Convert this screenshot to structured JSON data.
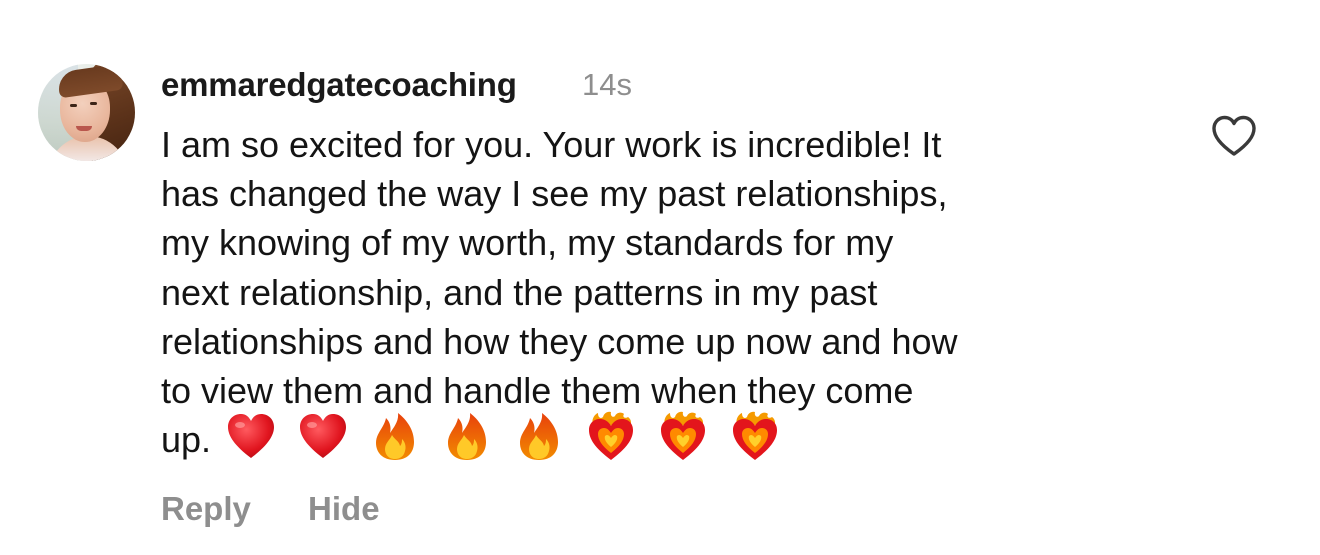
{
  "comment": {
    "username": "emmaredgatecoaching",
    "timestamp": "14s",
    "text_lines": [
      "I am so excited for you. Your work is incredible! It",
      "has changed the way I see my past relationships,",
      "my knowing of my worth, my standards for my",
      "next relationship, and the patterns in my past",
      "relationships and how they come up now and how",
      "to view them and handle them when they come",
      "up."
    ],
    "emojis": [
      "red-heart",
      "red-heart",
      "fire",
      "fire",
      "fire",
      "heart-on-fire",
      "heart-on-fire",
      "heart-on-fire"
    ],
    "actions": {
      "reply_label": "Reply",
      "hide_label": "Hide"
    },
    "like_icon": "heart-outline-icon",
    "colors": {
      "username": "#1a1a1a",
      "secondary": "#8e8e8e",
      "body": "#141414"
    }
  }
}
